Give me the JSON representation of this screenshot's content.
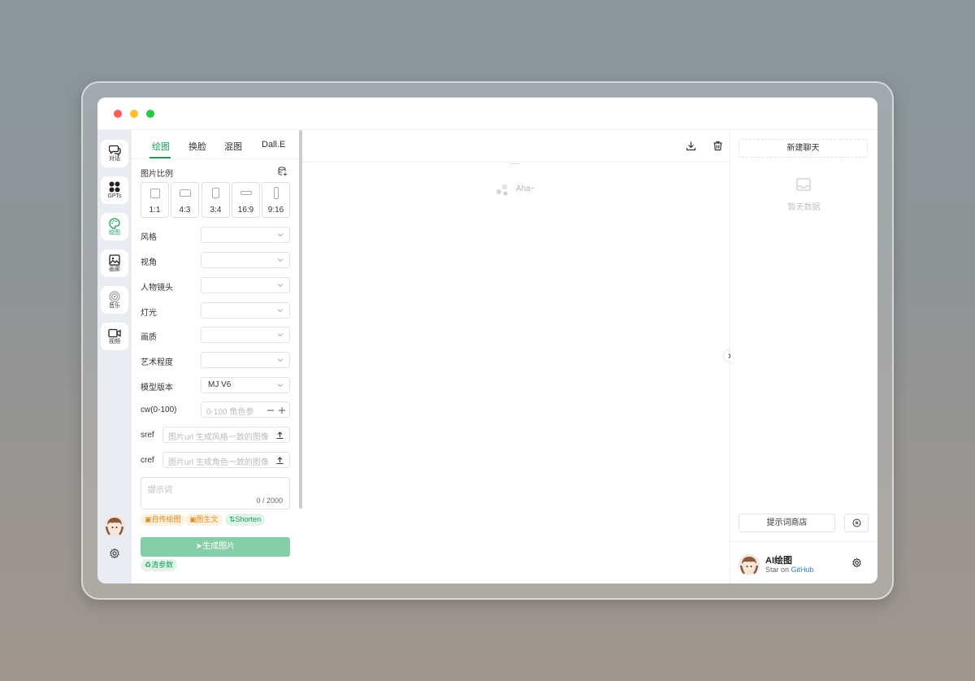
{
  "rail": {
    "items": [
      {
        "label": "对话",
        "icon": "chat-icon"
      },
      {
        "label": "GPTs",
        "icon": "apps-icon"
      },
      {
        "label": "绘图",
        "icon": "palette-icon",
        "active": true
      },
      {
        "label": "画廊",
        "icon": "image-icon"
      },
      {
        "label": "音乐",
        "icon": "disc-icon"
      },
      {
        "label": "视频",
        "icon": "video-icon"
      }
    ]
  },
  "panel": {
    "tabs": [
      "绘图",
      "换脸",
      "混图",
      "Dall.E"
    ],
    "ratio_label": "图片比例",
    "ratios": [
      "1:1",
      "4:3",
      "3:4",
      "16:9",
      "9:16"
    ],
    "fields": [
      {
        "label": "风格",
        "value": ""
      },
      {
        "label": "视角",
        "value": ""
      },
      {
        "label": "人物镜头",
        "value": ""
      },
      {
        "label": "灯光",
        "value": ""
      },
      {
        "label": "画质",
        "value": ""
      },
      {
        "label": "艺术程度",
        "value": ""
      },
      {
        "label": "模型版本",
        "value": "MJ V6"
      }
    ],
    "cw": {
      "label": "cw(0-100)",
      "placeholder": "0-100 角色参"
    },
    "sref": {
      "label": "sref",
      "placeholder": "图片url 生成风格一致的图像"
    },
    "cref": {
      "label": "cref",
      "placeholder": "图片url 生成角色一致的图像"
    },
    "prompt": {
      "placeholder": "提示词",
      "counter": "0 / 2000"
    },
    "tags": [
      "自传绘图",
      "图生文",
      "Shorten"
    ],
    "generate_label": "生成图片",
    "clear_label": "清参数"
  },
  "main": {
    "placeholder_text": "Aha~"
  },
  "right": {
    "new_chat_label": "新建聊天",
    "empty_label": "暂无数据",
    "prompt_shop_label": "提示词商店",
    "footer_title": "AI绘图",
    "footer_sub_prefix": "Star on",
    "footer_sub_link": "GitHub"
  },
  "colors": {
    "accent": "#18a058",
    "link": "#2f80ed"
  }
}
